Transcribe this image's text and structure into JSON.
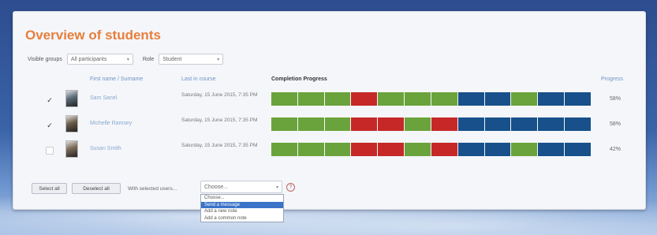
{
  "title": "Overview of students",
  "filters": {
    "group_label": "Visible groups",
    "group_value": "All participants",
    "role_label": "Role",
    "role_value": "Student"
  },
  "table": {
    "col_name": "First name / Surname",
    "col_access": "Last in course",
    "col_progress": "Completion Progress",
    "col_pct": "Progress",
    "rows": [
      {
        "checked": true,
        "name": "Sam Sanel",
        "access": "Saturday, 15 June 2015, 7:35 PM",
        "progress": [
          "g",
          "g",
          "g",
          "r",
          "g",
          "g",
          "g",
          "b",
          "b",
          "g",
          "b",
          "b"
        ],
        "pct": "58%"
      },
      {
        "checked": true,
        "name": "Michelle Ramsey",
        "access": "Saturday, 15 June 2015, 7:35 PM",
        "progress": [
          "g",
          "g",
          "g",
          "r",
          "r",
          "g",
          "r",
          "b",
          "b",
          "b",
          "b",
          "b"
        ],
        "pct": "58%"
      },
      {
        "checked": false,
        "name": "Susan Smith",
        "access": "Saturday, 15 June 2015, 7:35 PM",
        "progress": [
          "g",
          "g",
          "g",
          "r",
          "r",
          "g",
          "r",
          "b",
          "b",
          "g",
          "b",
          "b"
        ],
        "pct": "42%"
      }
    ]
  },
  "colors": {
    "g": "#6aa33b",
    "r": "#c62828",
    "b": "#17508a"
  },
  "actions": {
    "select_all": "Select all",
    "deselect_all": "Deselect all",
    "with_selected": "With selected users...",
    "choose": "Choose..."
  },
  "dropdown": {
    "options": [
      "Choose...",
      "Send a message",
      "Add a new note",
      "Add a common note"
    ],
    "highlighted_index": 1
  }
}
